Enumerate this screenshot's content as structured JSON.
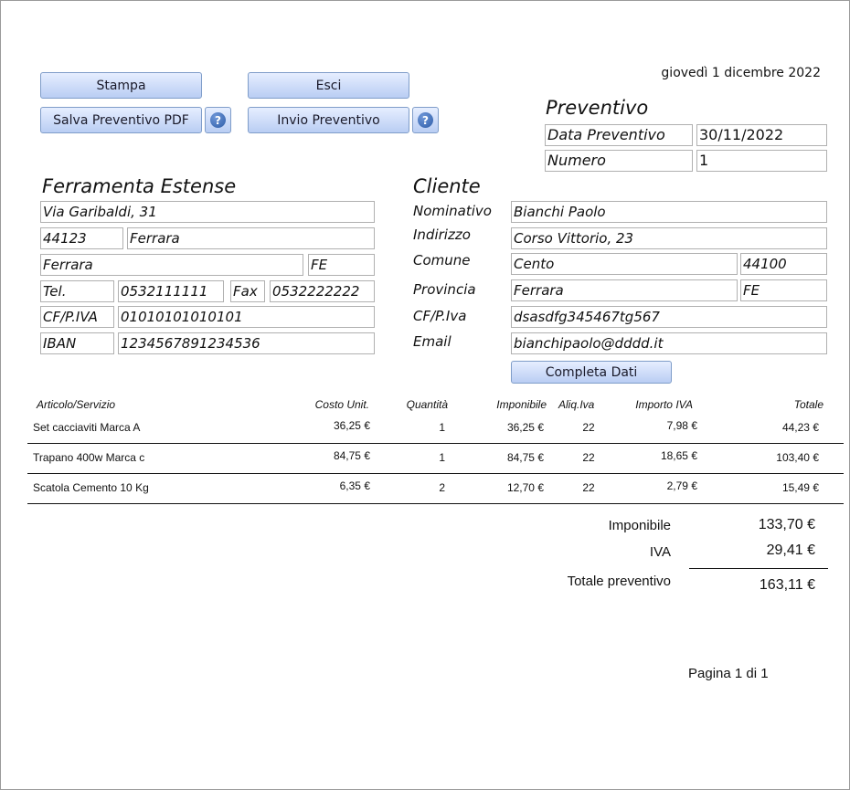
{
  "toolbar": {
    "print_label": "Stampa",
    "exit_label": "Esci",
    "save_pdf_label": "Salva Preventivo PDF",
    "send_label": "Invio Preventivo",
    "help_glyph": "?",
    "complete_label": "Completa Dati"
  },
  "date_header": "giovedì 1 dicembre 2022",
  "quote": {
    "title": "Preventivo",
    "date_label": "Data Preventivo",
    "date_value": "30/11/2022",
    "number_label": "Numero",
    "number_value": "1"
  },
  "company": {
    "name": "Ferramenta Estense",
    "address": "Via Garibaldi, 31",
    "cap": "44123",
    "city": "Ferrara",
    "municipality": "Ferrara",
    "province": "FE",
    "tel_label": "Tel.",
    "tel": "0532111111",
    "fax_label": "Fax",
    "fax": "0532222222",
    "vat_label": "CF/P.IVA",
    "vat": "01010101010101",
    "iban_label": "IBAN",
    "iban": "1234567891234536"
  },
  "client": {
    "title": "Cliente",
    "name_label": "Nominativo",
    "name": "Bianchi Paolo",
    "address_label": "Indirizzo",
    "address": "Corso Vittorio, 23",
    "municipality_label": "Comune",
    "municipality": "Cento",
    "cap": "44100",
    "province_label": "Provincia",
    "province": "Ferrara",
    "province_code": "FE",
    "vat_label": "CF/P.Iva",
    "vat": "dsasdfg345467tg567",
    "email_label": "Email",
    "email": "bianchipaolo@dddd.it"
  },
  "table": {
    "headers": {
      "item": "Articolo/Servizio",
      "unit_cost": "Costo Unit.",
      "qty": "Quantità",
      "taxable": "Imponibile",
      "vat_rate": "Aliq.Iva",
      "vat_amount": "Importo IVA",
      "total": "Totale"
    },
    "rows": [
      {
        "item": "Set cacciaviti Marca A",
        "unit_cost": "36,25 €",
        "qty": "1",
        "taxable": "36,25 €",
        "vat_rate": "22",
        "vat_amount": "7,98 €",
        "total": "44,23 €"
      },
      {
        "item": "Trapano 400w Marca c",
        "unit_cost": "84,75 €",
        "qty": "1",
        "taxable": "84,75 €",
        "vat_rate": "22",
        "vat_amount": "18,65 €",
        "total": "103,40 €"
      },
      {
        "item": "Scatola Cemento 10 Kg",
        "unit_cost": "6,35 €",
        "qty": "2",
        "taxable": "12,70 €",
        "vat_rate": "22",
        "vat_amount": "2,79 €",
        "total": "15,49 €"
      }
    ]
  },
  "totals": {
    "taxable_label": "Imponibile",
    "taxable": "133,70 €",
    "vat_label": "IVA",
    "vat": "29,41 €",
    "total_label": "Totale preventivo",
    "total": "163,11 €"
  },
  "footer": {
    "page": "Pagina 1 di 1"
  }
}
